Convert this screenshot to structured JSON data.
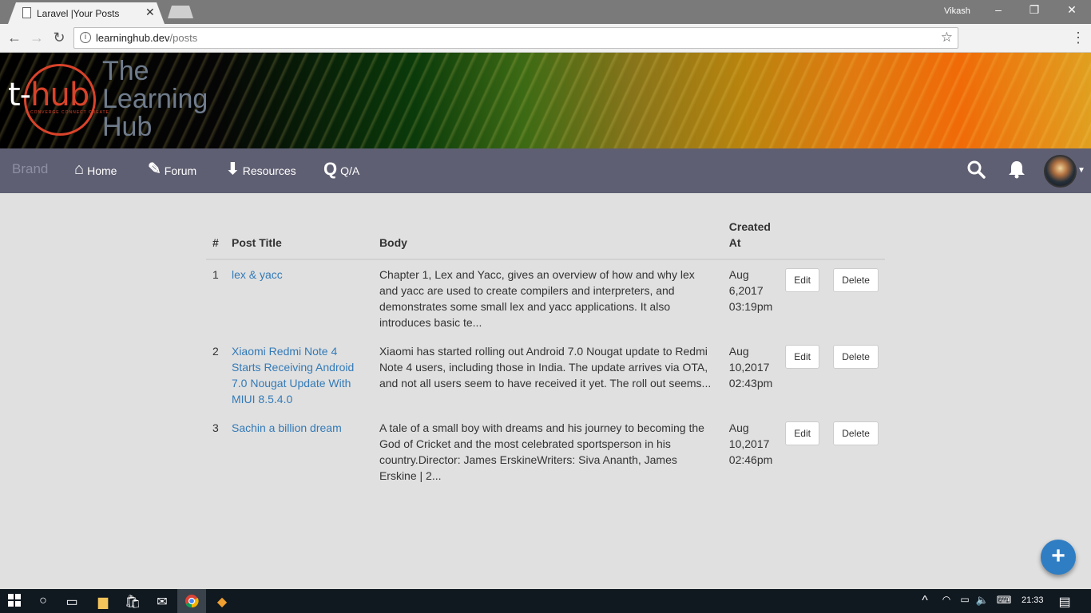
{
  "browser": {
    "tab_title": "Laravel |Your Posts",
    "tab_close": "✕",
    "user": "Vikash",
    "url_host": "learninghub.dev",
    "url_path": "/posts"
  },
  "site": {
    "logo_t": "t-",
    "logo_hub": "hub",
    "logo_tagline": "CONVERGE CONNECT CREATE",
    "title_line1": "The",
    "title_line2": "Learning",
    "title_line3": "Hub"
  },
  "navbar": {
    "brand": "Brand",
    "links": [
      {
        "label": "Home",
        "icon": "home-icon",
        "glyph": "⌂"
      },
      {
        "label": "Forum",
        "icon": "edit-icon",
        "glyph": "✎"
      },
      {
        "label": "Resources",
        "icon": "download-icon",
        "glyph": "⬇"
      },
      {
        "label": "Q/A",
        "icon": "q-icon",
        "glyph": "Q"
      }
    ]
  },
  "table": {
    "headers": {
      "num": "#",
      "title": "Post Title",
      "body": "Body",
      "created_line1": "Created",
      "created_line2": "At"
    },
    "rows": [
      {
        "num": "1",
        "title": "lex & yacc",
        "body": "Chapter 1, Lex and Yacc, gives an overview of how and why lex and yacc are used to create compilers and interpreters, and demonstrates some small lex and yacc applications. It also introduces basic te...",
        "date_line1": "Aug",
        "date_line2": "6,2017",
        "date_line3": "03:19pm",
        "edit": "Edit",
        "delete": "Delete"
      },
      {
        "num": "2",
        "title": "Xiaomi Redmi Note 4 Starts Receiving Android 7.0 Nougat Update With MIUI 8.5.4.0",
        "body": "Xiaomi has started rolling out Android 7.0 Nougat update to Redmi Note 4 users, including those in India. The update arrives via OTA, and not all users seem to have received it yet. The roll out seems...",
        "date_line1": "Aug",
        "date_line2": "10,2017",
        "date_line3": "02:43pm",
        "edit": "Edit",
        "delete": "Delete"
      },
      {
        "num": "3",
        "title": "Sachin a billion dream",
        "body": "A tale of a small boy with dreams and his journey to becoming the God of Cricket and the most celebrated sportsperson in his country.Director: James ErskineWriters: Siva Ananth, James Erskine | 2...",
        "date_line1": "Aug",
        "date_line2": "10,2017",
        "date_line3": "02:46pm",
        "edit": "Edit",
        "delete": "Delete"
      }
    ]
  },
  "fab": {
    "glyph": "+"
  },
  "taskbar": {
    "time": "21:33"
  },
  "colors": {
    "link": "#337ab7",
    "navbar": "#5f5f73",
    "fab": "#2f7ec4",
    "logo_accent": "#d8432a"
  }
}
